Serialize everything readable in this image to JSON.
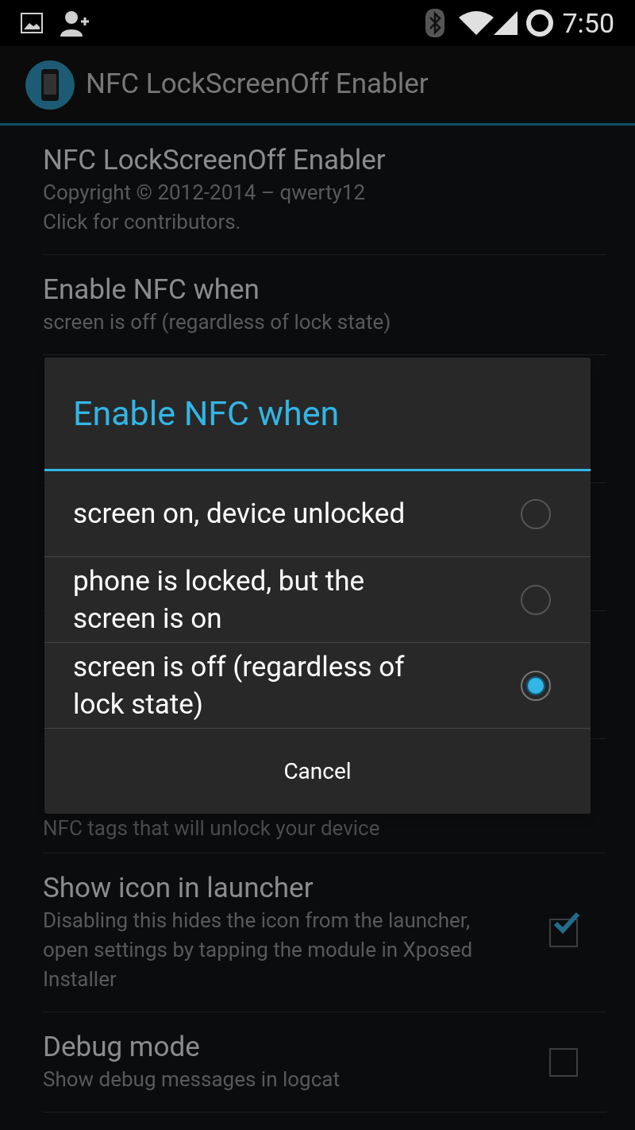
{
  "status_bar": {
    "time": "7:50"
  },
  "action_bar": {
    "title": "NFC LockScreenOff Enabler"
  },
  "preferences": [
    {
      "kind": "text",
      "title": "NFC LockScreenOff Enabler",
      "summary": "Copyright © 2012-2014 – qwerty12\nClick for contributors."
    },
    {
      "kind": "text",
      "title": "Enable NFC when",
      "summary": "screen is off (regardless of lock state)"
    },
    {
      "kind": "hidden"
    },
    {
      "kind": "hidden"
    },
    {
      "kind": "hidden"
    },
    {
      "kind": "partial",
      "summary": "NFC tags that will unlock your device"
    },
    {
      "kind": "checkbox",
      "title": "Show icon in launcher",
      "summary": "Disabling this hides the icon from the launcher, open settings by tapping the module in Xposed Installer",
      "checked": true
    },
    {
      "kind": "checkbox",
      "title": "Debug mode",
      "summary": "Show debug messages in logcat",
      "checked": false
    }
  ],
  "dialog": {
    "title": "Enable NFC when",
    "options": [
      {
        "label": "screen on, device unlocked",
        "selected": false
      },
      {
        "label": "phone is locked, but the screen is on",
        "selected": false
      },
      {
        "label": "screen is off (regardless of lock state)",
        "selected": true
      }
    ],
    "button": "Cancel"
  }
}
